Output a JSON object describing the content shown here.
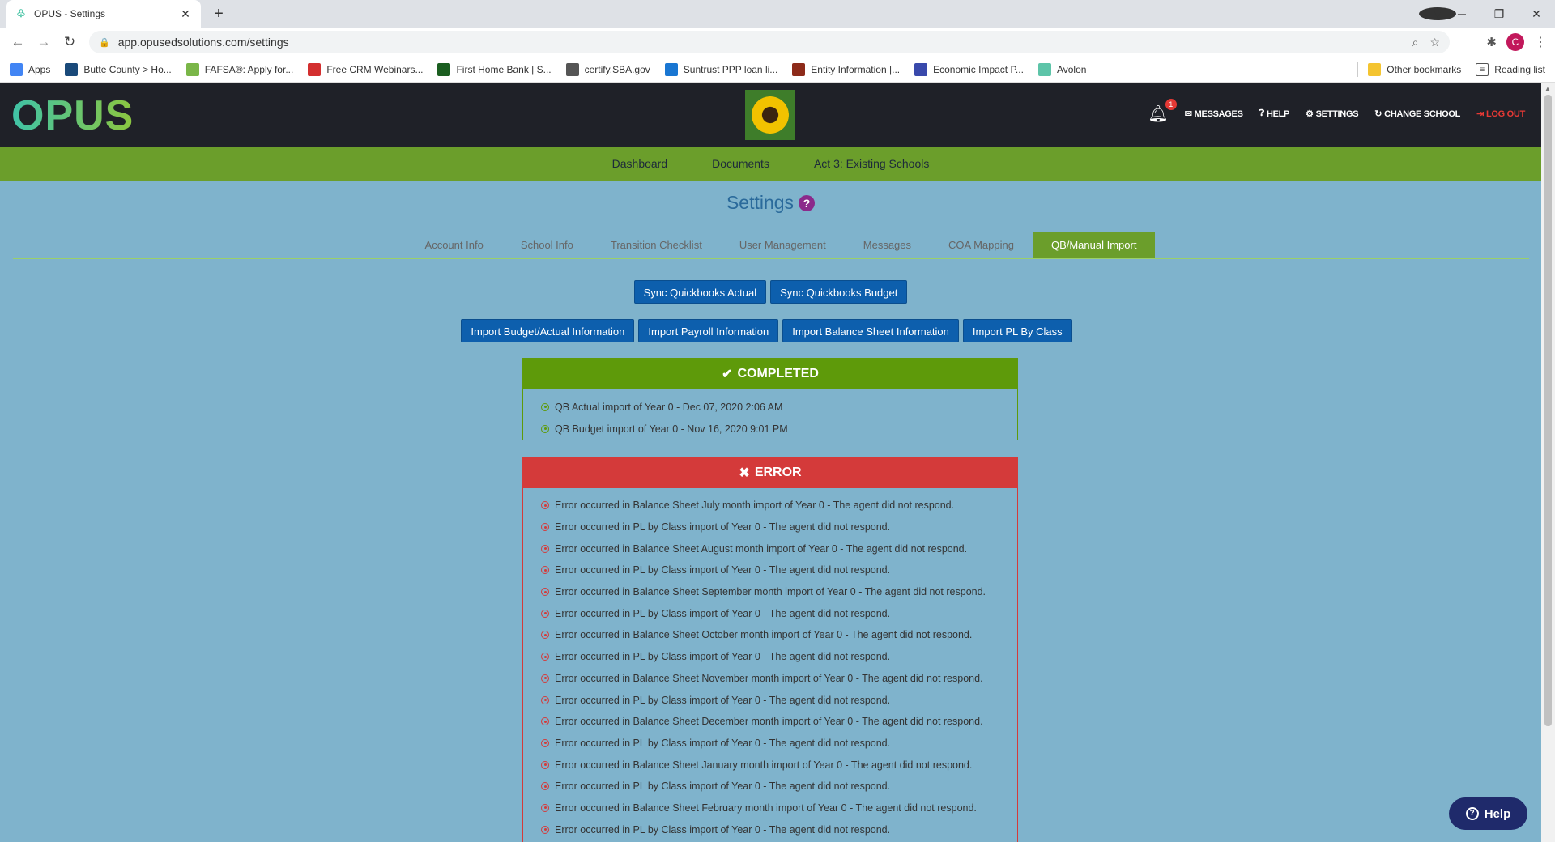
{
  "browser": {
    "tab_title": "OPUS - Settings",
    "url": "app.opusedsolutions.com/settings",
    "bookmarks": [
      {
        "label": "Apps",
        "color": "#4285f4"
      },
      {
        "label": "Butte County > Ho...",
        "color": "#1a4a7a"
      },
      {
        "label": "FAFSA®: Apply for...",
        "color": "#7ab648"
      },
      {
        "label": "Free CRM Webinars...",
        "color": "#d32f2f"
      },
      {
        "label": "First Home Bank | S...",
        "color": "#1b5e20"
      },
      {
        "label": "certify.SBA.gov",
        "color": "#555555"
      },
      {
        "label": "Suntrust PPP loan li...",
        "color": "#1976d2"
      },
      {
        "label": "Entity Information |...",
        "color": "#8d2b1a"
      },
      {
        "label": "Economic Impact P...",
        "color": "#3949ab"
      },
      {
        "label": "Avolon",
        "color": "#5dc4a8"
      }
    ],
    "other_bookmarks": "Other bookmarks",
    "reading_list": "Reading list",
    "profile_initial": "C"
  },
  "header": {
    "logo": "OPUS",
    "notification_count": "1",
    "links": {
      "messages": "MESSAGES",
      "help": "HELP",
      "settings": "SETTINGS",
      "change_school": "CHANGE SCHOOL",
      "logout": "LOG OUT"
    }
  },
  "main_nav": [
    "Dashboard",
    "Documents",
    "Act 3: Existing Schools"
  ],
  "page": {
    "title": "Settings",
    "help_glyph": "?"
  },
  "subtabs": [
    "Account Info",
    "School Info",
    "Transition Checklist",
    "User Management",
    "Messages",
    "COA Mapping",
    "QB/Manual Import"
  ],
  "sync_buttons": [
    "Sync Quickbooks Actual",
    "Sync Quickbooks Budget"
  ],
  "import_buttons": [
    "Import Budget/Actual Information",
    "Import Payroll Information",
    "Import Balance Sheet Information",
    "Import PL By Class"
  ],
  "completed": {
    "title": "COMPLETED",
    "items": [
      "QB Actual import of Year 0 - Dec 07, 2020 2:06 AM",
      "QB Budget import of Year 0 - Nov 16, 2020 9:01 PM"
    ]
  },
  "error": {
    "title": "ERROR",
    "items": [
      "Error occurred in Balance Sheet July month import of Year 0 - The agent did not respond.",
      "Error occurred in PL by Class import of Year 0 - The agent did not respond.",
      "Error occurred in Balance Sheet August month import of Year 0 - The agent did not respond.",
      "Error occurred in PL by Class import of Year 0 - The agent did not respond.",
      "Error occurred in Balance Sheet September month import of Year 0 - The agent did not respond.",
      "Error occurred in PL by Class import of Year 0 - The agent did not respond.",
      "Error occurred in Balance Sheet October month import of Year 0 - The agent did not respond.",
      "Error occurred in PL by Class import of Year 0 - The agent did not respond.",
      "Error occurred in Balance Sheet November month import of Year 0 - The agent did not respond.",
      "Error occurred in PL by Class import of Year 0 - The agent did not respond.",
      "Error occurred in Balance Sheet December month import of Year 0 - The agent did not respond.",
      "Error occurred in PL by Class import of Year 0 - The agent did not respond.",
      "Error occurred in Balance Sheet January month import of Year 0 - The agent did not respond.",
      "Error occurred in PL by Class import of Year 0 - The agent did not respond.",
      "Error occurred in Balance Sheet February month import of Year 0 - The agent did not respond.",
      "Error occurred in PL by Class import of Year 0 - The agent did not respond."
    ]
  },
  "help_widget": "Help",
  "colors": {
    "page_bg": "#7fb3cc",
    "header_bg": "#1f2128",
    "nav_green": "#6b9e2b",
    "button_blue": "#0d5fad",
    "success": "#5e9a0a",
    "danger": "#d43a3a"
  }
}
